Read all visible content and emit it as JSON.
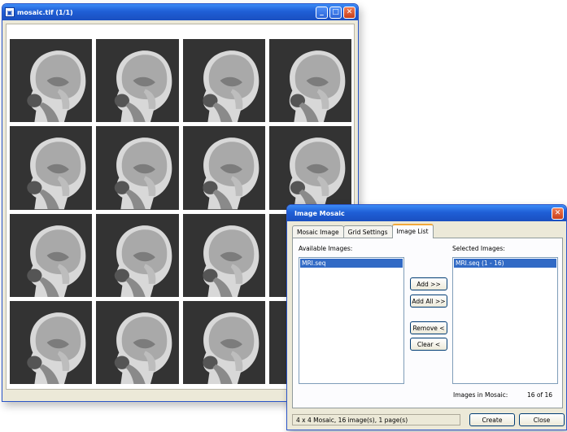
{
  "mosaic_window": {
    "title": "mosaic.tif (1/1)",
    "buttons": {
      "minimize": "_",
      "maximize": "□",
      "close": "✕"
    },
    "thumbnail_count": 16
  },
  "dialog": {
    "title": "Image Mosaic",
    "close_label": "✕",
    "tabs": [
      {
        "label": "Mosaic Image",
        "active": false
      },
      {
        "label": "Grid Settings",
        "active": false
      },
      {
        "label": "Image List",
        "active": true
      }
    ],
    "available": {
      "label": "Available Images:",
      "items": [
        "MRI.seq"
      ]
    },
    "selected": {
      "label": "Selected Images:",
      "items": [
        "MRI.seq (1 - 16)"
      ]
    },
    "buttons": {
      "add": "Add >>",
      "add_all": "Add All >>",
      "remove": "Remove <",
      "clear": "Clear <",
      "create": "Create",
      "close": "Close"
    },
    "images_in_mosaic_label": "Images in Mosaic:",
    "images_in_mosaic_value": "16 of 16",
    "status": "4 x 4 Mosaic, 16 image(s), 1 page(s)"
  },
  "colors": {
    "titlebar": "#1f5fd6",
    "selection": "#316ac5",
    "window_face": "#ece9d8",
    "close_button": "#c9401b"
  }
}
